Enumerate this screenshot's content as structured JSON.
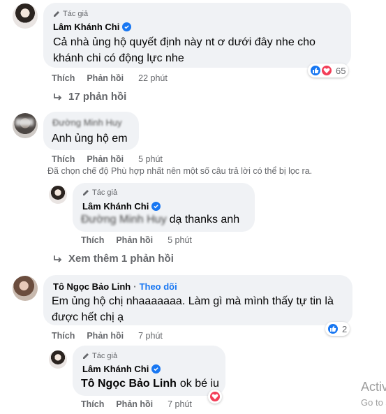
{
  "author_badge_label": "Tác giả",
  "comments": [
    {
      "author": "Lâm Khánh Chi",
      "verified": true,
      "text_line1": "Cả nhà ủng hộ quyết định này nt ơ dưới đây nhe cho",
      "text_line2": "khánh chi có động lực nhe",
      "like_label": "Thích",
      "reply_label": "Phản hồi",
      "time": "22 phút",
      "reaction_count": "65",
      "reactions": [
        "like",
        "love"
      ],
      "replies_toggle": "17 phản hồi"
    },
    {
      "author": "Đường Minh Huy",
      "text": "Anh ủng hộ em",
      "like_label": "Thích",
      "reply_label": "Phản hồi",
      "time": "5 phút"
    },
    {
      "author": "Tô Ngọc Bảo Linh",
      "follow_label": "Theo dõi",
      "text_line1": "Em ủng hộ chị nhaaaaaaa. Làm gì mà mình thấy tự tin là",
      "text_line2": "được hết chị ạ",
      "like_label": "Thích",
      "reply_label": "Phản hồi",
      "time": "7 phút",
      "reaction_count": "2",
      "reactions": [
        "like"
      ]
    }
  ],
  "filter_notice": "Đã chọn chế độ Phù hợp nhất nên một số câu trả lời có thể bị lọc ra.",
  "replies": [
    {
      "author": "Lâm Khánh Chi",
      "verified": true,
      "mention": "Đường Minh Huy",
      "text": "dạ thanks anh",
      "like_label": "Thích",
      "reply_label": "Phản hồi",
      "time": "5 phút"
    },
    {
      "author": "Lâm Khánh Chi",
      "verified": true,
      "mention": "Tô Ngọc Bảo Linh",
      "text": "ok bé iu",
      "like_label": "Thích",
      "reply_label": "Phản hồi",
      "time": "7 phút",
      "reactions": [
        "love"
      ]
    }
  ],
  "see_more_replies": "Xem thêm 1 phản hồi",
  "watermark": {
    "line1": "Activ",
    "line2": "Go to s"
  },
  "colors": {
    "bubble": "#f0f2f5",
    "secondary_text": "#65676b",
    "link_blue": "#1877f2",
    "love_red": "#f33e58"
  }
}
